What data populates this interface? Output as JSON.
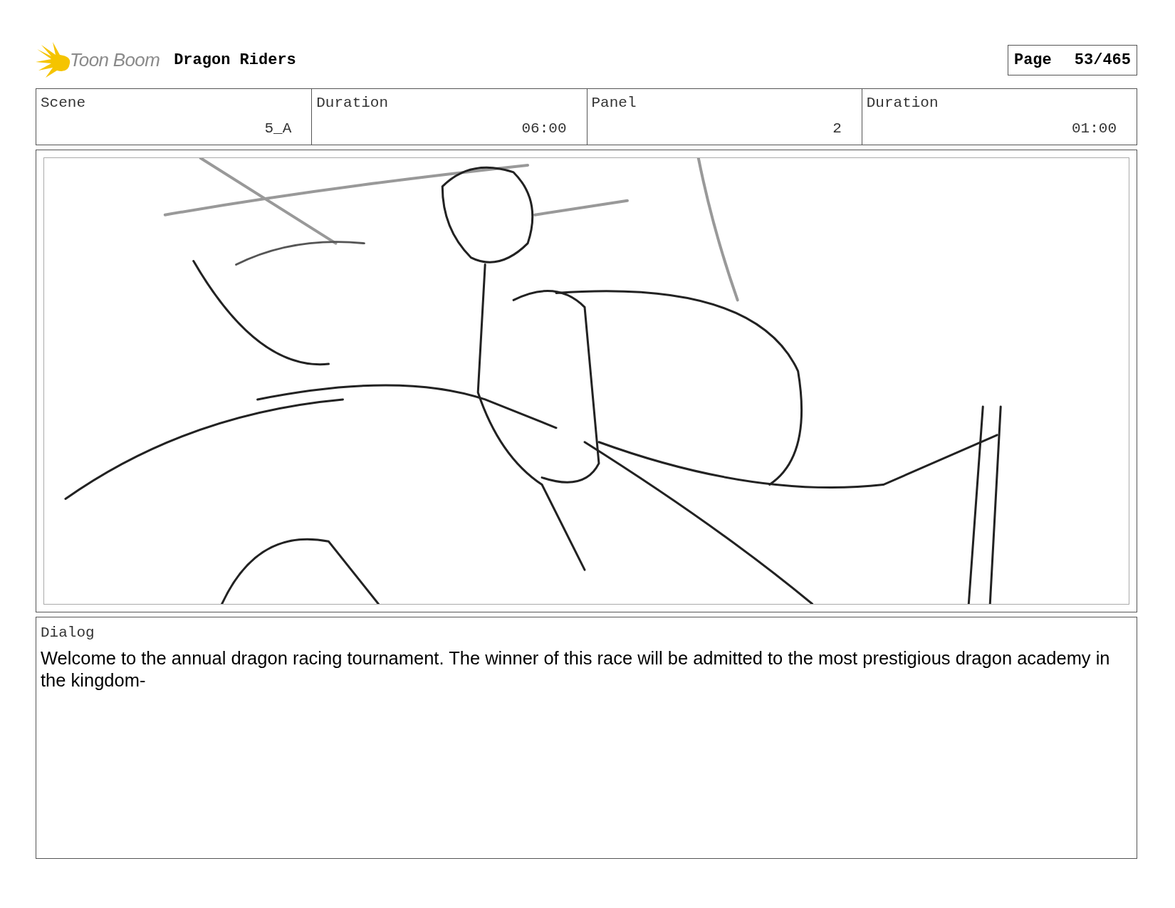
{
  "header": {
    "logo_text": "Toon Boom",
    "project_title": "Dragon Riders",
    "page_label": "Page",
    "page_number": "53/465"
  },
  "fields": [
    {
      "label": "Scene",
      "value": "5_A"
    },
    {
      "label": "Duration",
      "value": "06:00"
    },
    {
      "label": "Panel",
      "value": "2"
    },
    {
      "label": "Duration",
      "value": "01:00"
    }
  ],
  "dialog": {
    "label": "Dialog",
    "text": "Welcome to the annual dragon racing tournament. The winner of this race will be admitted to the most prestigious dragon academy in the kingdom-"
  }
}
